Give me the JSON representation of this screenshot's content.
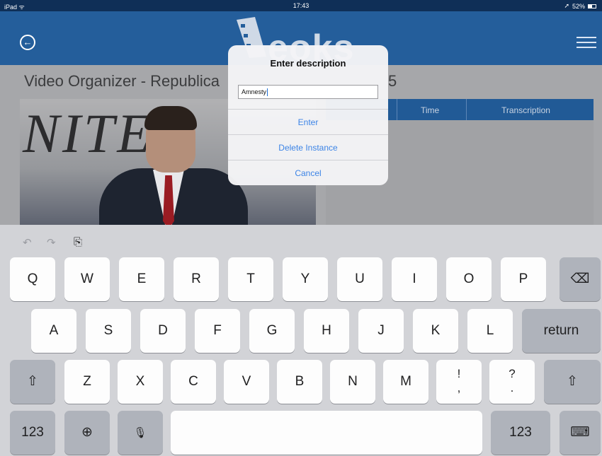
{
  "status_bar": {
    "device": "iPad ᯤ",
    "time": "17:43",
    "location_arrow": "➚",
    "battery": "52%"
  },
  "header": {
    "logo_text": "eoks"
  },
  "page": {
    "title": "Video Organizer - Republica",
    "title_suffix": "5"
  },
  "video": {
    "banner_text": "NITE"
  },
  "table": {
    "columns": [
      "Time",
      "Transcription"
    ]
  },
  "dialog": {
    "title": "Enter description",
    "input_value": "Amnesty",
    "enter_label": "Enter",
    "delete_label": "Delete Instance",
    "cancel_label": "Cancel"
  },
  "keyboard": {
    "undo_icon": "↶",
    "redo_icon": "↷",
    "paste_icon": "⎘",
    "row1": [
      "Q",
      "W",
      "E",
      "R",
      "T",
      "Y",
      "U",
      "I",
      "O",
      "P"
    ],
    "row2": [
      "A",
      "S",
      "D",
      "F",
      "G",
      "H",
      "J",
      "K",
      "L"
    ],
    "row3": [
      "Z",
      "X",
      "C",
      "V",
      "B",
      "N",
      "M"
    ],
    "backspace_icon": "⌫",
    "return_label": "return",
    "shift_icon": "⇧",
    "excl_top": "!",
    "excl_bottom": ",",
    "quest_top": "?",
    "quest_bottom": ".",
    "numbers_label": "123",
    "globe_icon": "⊕",
    "mic_icon": "🎙",
    "hide_keyboard_icon": "⌨"
  }
}
